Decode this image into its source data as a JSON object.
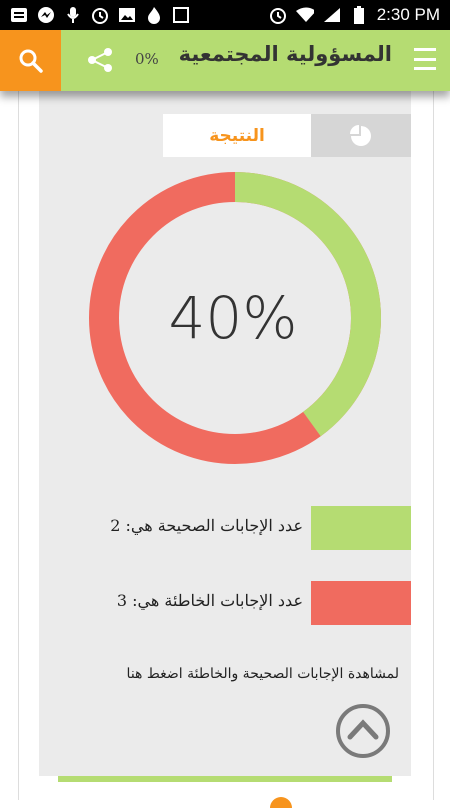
{
  "status_bar": {
    "time": "2:30 PM",
    "left_icons": [
      "notification-icon",
      "messenger-icon",
      "microphone-icon",
      "alarm-icon",
      "image-icon",
      "fire-icon",
      "square-icon"
    ],
    "right_icons": [
      "alarm-icon",
      "wifi-icon",
      "signal-icon",
      "battery-icon"
    ]
  },
  "app_bar": {
    "title": "المسؤولية المجتمعية",
    "progress_label": "0%",
    "icons": {
      "search": "search-icon",
      "share": "share-icon",
      "menu": "menu-icon"
    },
    "colors": {
      "bar": "#b5dc72",
      "search_bg": "#f7941d"
    }
  },
  "tabs": {
    "result_label": "النتيجة",
    "chart_icon": "pie-chart-icon",
    "active_color": "#f7941d"
  },
  "result": {
    "percent_text": "40%",
    "correct_fraction": 0.4,
    "colors": {
      "correct": "#b5dc72",
      "wrong": "#f06b5f"
    }
  },
  "legend": {
    "correct_text": "عدد الإجابات الصحيحة هي: 2",
    "wrong_text": "عدد الإجابات الخاطئة هي: 3"
  },
  "hint_text": "لمشاهدة الإجابات الصحيحة والخاطئة اضغط هنا",
  "scroll_up_icon": "chevron-up-icon"
}
